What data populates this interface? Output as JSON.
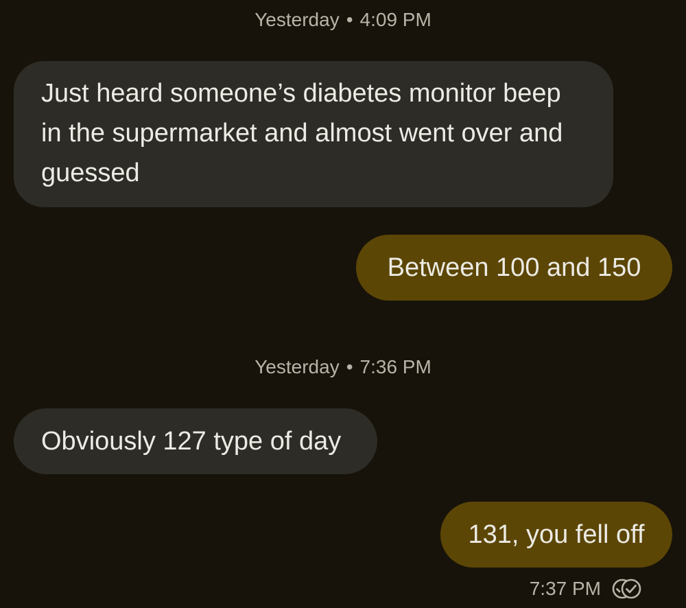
{
  "conversation": {
    "sections": [
      {
        "timestamp": {
          "day": "Yesterday",
          "separator": "•",
          "time": "4:09 PM"
        }
      },
      {
        "timestamp": {
          "day": "Yesterday",
          "separator": "•",
          "time": "7:36 PM"
        }
      }
    ],
    "messages": [
      {
        "direction": "incoming",
        "text": "Just heard someone’s diabetes monitor beep in the supermarket and almost went over and guessed"
      },
      {
        "direction": "outgoing",
        "text": "Between 100 and 150"
      },
      {
        "direction": "incoming",
        "text": "Obviously 127 type of day"
      },
      {
        "direction": "outgoing",
        "text": "131, you fell off"
      }
    ],
    "last_status": {
      "time": "7:37 PM",
      "icon": "delivered-read-check-icon"
    }
  },
  "colors": {
    "background": "#17130a",
    "incoming_bubble": "#2e2c26",
    "outgoing_bubble": "#5c4606",
    "text": "#ecebe4",
    "meta_text": "#b8b4a8"
  }
}
